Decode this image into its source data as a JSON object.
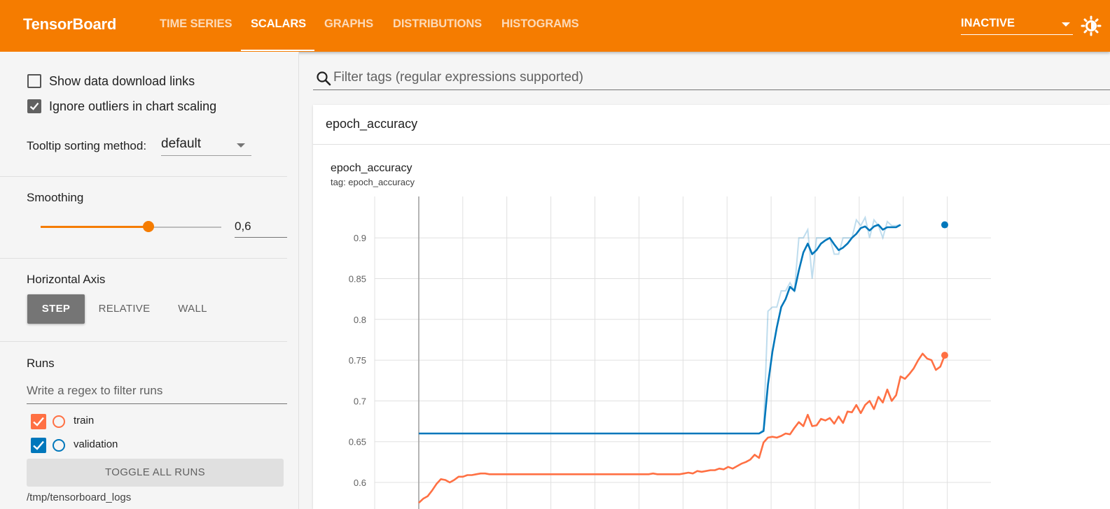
{
  "header": {
    "brand": "TensorBoard",
    "tabs": [
      {
        "label": "TIME SERIES",
        "active": false
      },
      {
        "label": "SCALARS",
        "active": true
      },
      {
        "label": "GRAPHS",
        "active": false
      },
      {
        "label": "DISTRIBUTIONS",
        "active": false
      },
      {
        "label": "HISTOGRAMS",
        "active": false
      }
    ],
    "status_select": "INACTIVE",
    "accent_color": "#f57c00"
  },
  "sidebar": {
    "show_download_links": {
      "label": "Show data download links",
      "checked": false
    },
    "ignore_outliers": {
      "label": "Ignore outliers in chart scaling",
      "checked": true
    },
    "tooltip_sorting": {
      "label": "Tooltip sorting method:",
      "value": "default"
    },
    "smoothing": {
      "label": "Smoothing",
      "value": "0,6",
      "level": 0.6
    },
    "horizontal_axis": {
      "label": "Horizontal Axis",
      "options": [
        "STEP",
        "RELATIVE",
        "WALL"
      ],
      "selected": "STEP"
    },
    "runs": {
      "label": "Runs",
      "filter_placeholder": "Write a regex to filter runs",
      "items": [
        {
          "name": "train",
          "checked": true,
          "color": "#ff7043"
        },
        {
          "name": "validation",
          "checked": true,
          "color": "#0077bb"
        }
      ],
      "toggle_all_label": "TOGGLE ALL RUNS",
      "logdir": "/tmp/tensorboard_logs"
    }
  },
  "main": {
    "filter_placeholder": "Filter tags (regular expressions supported)",
    "card": {
      "header_title": "epoch_accuracy",
      "chart_title": "epoch_accuracy",
      "chart_tag": "tag: epoch_accuracy"
    }
  },
  "chart_data": {
    "type": "line",
    "title": "epoch_accuracy",
    "subtitle": "tag: epoch_accuracy",
    "xlabel": "",
    "ylabel": "",
    "x": [
      0,
      1,
      2,
      3,
      4,
      5,
      6,
      7,
      8,
      9,
      10,
      11,
      12,
      13,
      14,
      15,
      16,
      17,
      18,
      19,
      20,
      21,
      22,
      23,
      24,
      25,
      26,
      27,
      28,
      29,
      30,
      31,
      32,
      33,
      34,
      35,
      36,
      37,
      38,
      39,
      40,
      41,
      42,
      43,
      44,
      45,
      46,
      47,
      48,
      49,
      50,
      51,
      52,
      53,
      54,
      55,
      56,
      57,
      58,
      59,
      60,
      61,
      62,
      63,
      64,
      65,
      66,
      67,
      68,
      69,
      70,
      71,
      72,
      73,
      74,
      75,
      76,
      77,
      78,
      79,
      80,
      81,
      82,
      83,
      84,
      85,
      86,
      87,
      88,
      89,
      90,
      91,
      92,
      93,
      94,
      95,
      96,
      97,
      98,
      99,
      100,
      101,
      102,
      103,
      104,
      105,
      106,
      107,
      108,
      109,
      110,
      111,
      112,
      113,
      114,
      115,
      116,
      117,
      118,
      119
    ],
    "ylim": [
      0.575,
      0.95
    ],
    "yticks": [
      0.6,
      0.65,
      0.7,
      0.75,
      0.8,
      0.85,
      0.9
    ],
    "grid": true,
    "series": [
      {
        "name": "validation",
        "color": "#0077bb",
        "values": [
          0.66,
          0.66,
          0.66,
          0.66,
          0.66,
          0.66,
          0.66,
          0.66,
          0.66,
          0.66,
          0.66,
          0.66,
          0.66,
          0.66,
          0.66,
          0.66,
          0.66,
          0.66,
          0.66,
          0.66,
          0.66,
          0.66,
          0.66,
          0.66,
          0.66,
          0.66,
          0.66,
          0.66,
          0.66,
          0.66,
          0.66,
          0.66,
          0.66,
          0.66,
          0.66,
          0.66,
          0.66,
          0.66,
          0.66,
          0.66,
          0.66,
          0.66,
          0.66,
          0.66,
          0.66,
          0.66,
          0.66,
          0.66,
          0.66,
          0.66,
          0.66,
          0.66,
          0.66,
          0.66,
          0.66,
          0.66,
          0.66,
          0.66,
          0.66,
          0.66,
          0.66,
          0.66,
          0.66,
          0.66,
          0.66,
          0.66,
          0.66,
          0.66,
          0.66,
          0.66,
          0.66,
          0.66,
          0.66,
          0.66,
          0.66,
          0.66,
          0.66,
          0.66,
          0.663,
          0.72,
          0.76,
          0.79,
          0.815,
          0.825,
          0.84,
          0.835,
          0.86,
          0.882,
          0.893,
          0.88,
          0.885,
          0.893,
          0.897,
          0.9,
          0.892,
          0.885,
          0.888,
          0.893,
          0.9,
          0.905,
          0.912,
          0.914,
          0.909,
          0.914,
          0.916,
          0.91,
          0.913,
          0.913,
          0.913,
          0.916
        ],
        "raw_values": [
          0.66,
          0.66,
          0.66,
          0.66,
          0.66,
          0.66,
          0.66,
          0.66,
          0.66,
          0.66,
          0.66,
          0.66,
          0.66,
          0.66,
          0.66,
          0.66,
          0.66,
          0.66,
          0.66,
          0.66,
          0.66,
          0.66,
          0.66,
          0.66,
          0.66,
          0.66,
          0.66,
          0.66,
          0.66,
          0.66,
          0.66,
          0.66,
          0.66,
          0.66,
          0.66,
          0.66,
          0.66,
          0.66,
          0.66,
          0.66,
          0.66,
          0.66,
          0.66,
          0.66,
          0.66,
          0.66,
          0.66,
          0.66,
          0.66,
          0.66,
          0.66,
          0.66,
          0.66,
          0.66,
          0.66,
          0.66,
          0.66,
          0.66,
          0.66,
          0.66,
          0.66,
          0.66,
          0.66,
          0.66,
          0.66,
          0.66,
          0.66,
          0.66,
          0.66,
          0.66,
          0.66,
          0.66,
          0.66,
          0.66,
          0.66,
          0.66,
          0.66,
          0.66,
          0.665,
          0.81,
          0.815,
          0.815,
          0.835,
          0.835,
          0.845,
          0.835,
          0.9,
          0.9,
          0.91,
          0.85,
          0.9,
          0.9,
          0.9,
          0.9,
          0.88,
          0.88,
          0.9,
          0.9,
          0.9,
          0.922,
          0.915,
          0.925,
          0.9,
          0.922,
          0.915,
          0.9,
          0.92,
          0.915,
          0.915,
          0.916
        ]
      },
      {
        "name": "train",
        "color": "#ff7043",
        "values": [
          0.575,
          0.58,
          0.583,
          0.59,
          0.598,
          0.604,
          0.603,
          0.6,
          0.603,
          0.607,
          0.607,
          0.609,
          0.609,
          0.61,
          0.611,
          0.611,
          0.61,
          0.61,
          0.61,
          0.61,
          0.61,
          0.61,
          0.61,
          0.61,
          0.61,
          0.61,
          0.61,
          0.61,
          0.61,
          0.61,
          0.61,
          0.61,
          0.61,
          0.61,
          0.61,
          0.61,
          0.61,
          0.61,
          0.61,
          0.61,
          0.61,
          0.61,
          0.61,
          0.61,
          0.61,
          0.61,
          0.61,
          0.61,
          0.61,
          0.61,
          0.61,
          0.61,
          0.61,
          0.611,
          0.61,
          0.61,
          0.61,
          0.61,
          0.61,
          0.61,
          0.611,
          0.612,
          0.611,
          0.614,
          0.613,
          0.614,
          0.615,
          0.615,
          0.617,
          0.616,
          0.619,
          0.617,
          0.62,
          0.623,
          0.625,
          0.628,
          0.634,
          0.63,
          0.649,
          0.655,
          0.656,
          0.655,
          0.657,
          0.66,
          0.659,
          0.667,
          0.674,
          0.669,
          0.683,
          0.669,
          0.67,
          0.678,
          0.676,
          0.679,
          0.672,
          0.681,
          0.673,
          0.687,
          0.686,
          0.695,
          0.685,
          0.695,
          0.7,
          0.69,
          0.705,
          0.698,
          0.714,
          0.7,
          0.707,
          0.73,
          0.727,
          0.733,
          0.74,
          0.75,
          0.758,
          0.752,
          0.75,
          0.738,
          0.742,
          0.756
        ]
      }
    ]
  }
}
